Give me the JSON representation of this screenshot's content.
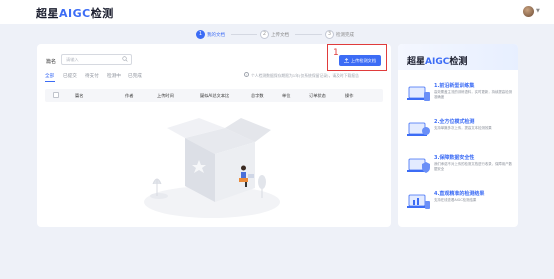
{
  "header": {
    "logo_prefix": "超星",
    "logo_accent": "AIGC",
    "logo_suffix": "检测"
  },
  "steps": [
    {
      "num": "1",
      "label": "我的文档",
      "active": true
    },
    {
      "num": "2",
      "label": "上传文档",
      "active": false
    },
    {
      "num": "3",
      "label": "检测完成",
      "active": false
    }
  ],
  "search": {
    "label": "篇名",
    "placeholder": "请输入"
  },
  "upload": {
    "label": "上传检测文档",
    "annotation_number": "1"
  },
  "tabs": [
    {
      "label": "全部",
      "active": true
    },
    {
      "label": "已提交",
      "active": false
    },
    {
      "label": "待支付",
      "active": false
    },
    {
      "label": "检测中",
      "active": false
    },
    {
      "label": "已完成",
      "active": false
    }
  ],
  "notice": "个人检测数据保存期限为1年(仅系统保留记录)，请及时下载报告",
  "table": {
    "columns": [
      "篇名",
      "作者",
      "上传时间",
      "疑似AI总文本比",
      "总字数",
      "单位",
      "订单状态",
      "操作"
    ]
  },
  "sidebar": {
    "title_prefix": "超星",
    "title_accent": "AIGC",
    "title_suffix": "检测",
    "features": [
      {
        "title": "1.前沿新型训练集",
        "desc": "高效覆盖主流的训练语料，实时更新，持续提高检测准确度"
      },
      {
        "title": "2.全方位模式检测",
        "desc": "支持单篇多次上传，提高文本检测效果"
      },
      {
        "title": "3.保障数据安全性",
        "desc": "我们承诺不对上传的检测文档进行收录，保障用户数据安全"
      },
      {
        "title": "4.直观精准的检测结果",
        "desc": "支持在线查看AIGC检测结果"
      }
    ]
  },
  "colors": {
    "accent": "#3c6cf5",
    "highlight": "#e03b3b"
  }
}
